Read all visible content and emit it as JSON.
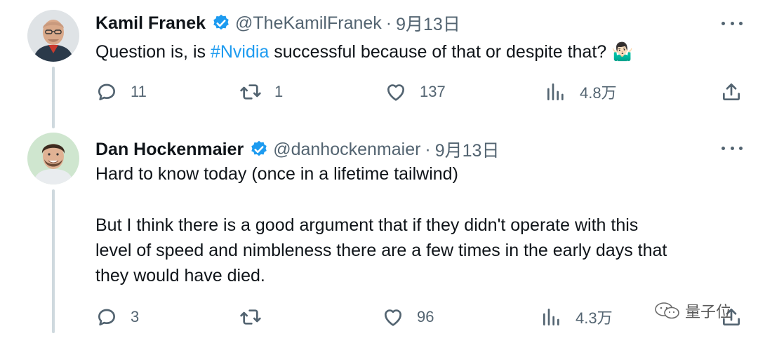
{
  "tweets": [
    {
      "author": "Kamil Franek",
      "handle": "@TheKamilFranek",
      "separator": "·",
      "date": "9月13日",
      "text_before": "Question is, is ",
      "hashtag": "#Nvidia",
      "text_after": " successful because of that or despite that? ",
      "emoji": "🤷🏻‍♂️",
      "replies": "11",
      "retweets": "1",
      "likes": "137",
      "views": "4.8万",
      "avatar_icon": "avatar-bald-man-glasses"
    },
    {
      "author": "Dan Hockenmaier",
      "handle": "@danhockenmaier",
      "separator": "·",
      "date": "9月13日",
      "line1": "Hard to know today (once in a lifetime tailwind)",
      "line2": "But I think there is a good argument that if they didn't operate with this",
      "line3": "level of speed and nimbleness there are a few times in the early days that",
      "line4": "they would have died.",
      "replies": "3",
      "retweets": "",
      "likes": "96",
      "views": "4.3万",
      "avatar_icon": "avatar-smiling-man"
    }
  ],
  "watermark": {
    "text": "量子位",
    "icon": "wechat-icon"
  },
  "colors": {
    "accent": "#1d9bf0",
    "muted": "#536471",
    "text": "#0f1419",
    "thread": "#cfd9de"
  }
}
